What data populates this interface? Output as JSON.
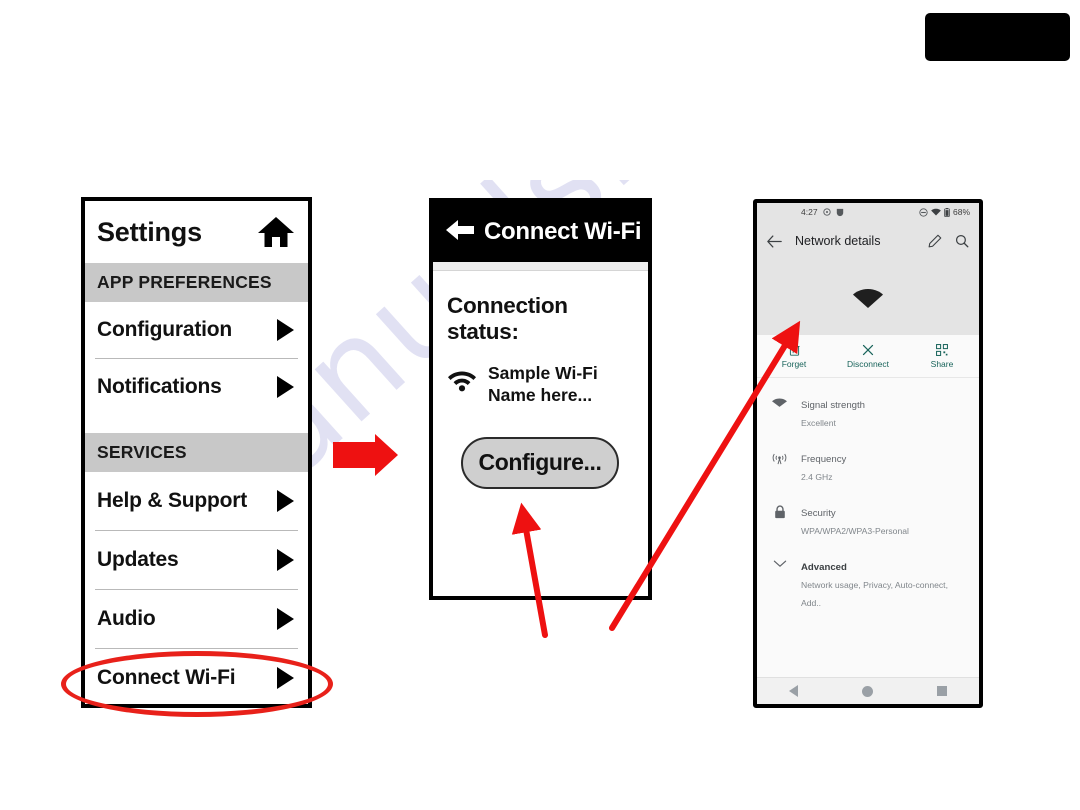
{
  "page": {
    "watermark_text": "manualshive.com",
    "accent_red": "#e8211a",
    "teal": "#19645b"
  },
  "redaction": {
    "name": "redacted-logo-block",
    "color": "#000000"
  },
  "settings_panel": {
    "title": "Settings",
    "home_icon": "home-icon",
    "sections": [
      {
        "heading": "APP PREFERENCES",
        "items": [
          {
            "label": "Configuration",
            "caret": "chevron-right-icon"
          },
          {
            "label": "Notifications",
            "caret": "chevron-right-icon"
          }
        ]
      },
      {
        "heading": "SERVICES",
        "items": [
          {
            "label": "Help & Support",
            "caret": "chevron-right-icon"
          },
          {
            "label": "Updates",
            "caret": "chevron-right-icon"
          },
          {
            "label": "Audio",
            "caret": "chevron-right-icon"
          },
          {
            "label": "Connect Wi-Fi",
            "caret": "chevron-right-icon"
          }
        ]
      }
    ],
    "highlight_target": "Connect Wi-Fi"
  },
  "wifi_panel": {
    "back_icon": "back-arrow-icon",
    "title": "Connect Wi-Fi",
    "status_label": "Connection status:",
    "wifi_icon": "wifi-icon",
    "ssid": "Sample Wi-Fi Name here...",
    "button_label": "Configure..."
  },
  "phone": {
    "status_bar": {
      "time": "4:27",
      "left_icons": [
        "alarm-icon",
        "app-notification-icon"
      ],
      "right_icons": [
        "do-not-disturb-icon",
        "wifi-icon",
        "battery-icon"
      ],
      "battery": "68%"
    },
    "app_bar": {
      "back_icon": "back-arrow-icon",
      "title": "Network details",
      "edit_icon": "pencil-icon",
      "search_icon": "search-icon"
    },
    "hero_icon": "wifi-signal-icon",
    "actions": [
      {
        "icon": "trash-icon",
        "label": "Forget"
      },
      {
        "icon": "close-x-icon",
        "label": "Disconnect"
      },
      {
        "icon": "qr-code-icon",
        "label": "Share"
      }
    ],
    "details": [
      {
        "icon": "wifi-icon",
        "key": "Signal strength",
        "value": "Excellent"
      },
      {
        "icon": "frequency-icon",
        "key": "Frequency",
        "value": "2.4 GHz"
      },
      {
        "icon": "lock-icon",
        "key": "Security",
        "value": "WPA/WPA2/WPA3-Personal"
      },
      {
        "icon": "chevron-down-icon",
        "key": "Advanced",
        "value": "Network usage, Privacy, Auto-connect, Add.."
      }
    ],
    "nav_bar": [
      "back-triangle-icon",
      "home-circle-icon",
      "recents-square-icon"
    ]
  },
  "arrows": [
    {
      "name": "flow-arrow-settings-to-wifi",
      "kind": "straight-right"
    },
    {
      "name": "callout-arrow-to-configure-button",
      "kind": "diagonal-up-left"
    },
    {
      "name": "callout-arrow-to-phone-screen",
      "kind": "diagonal-up-right"
    }
  ]
}
